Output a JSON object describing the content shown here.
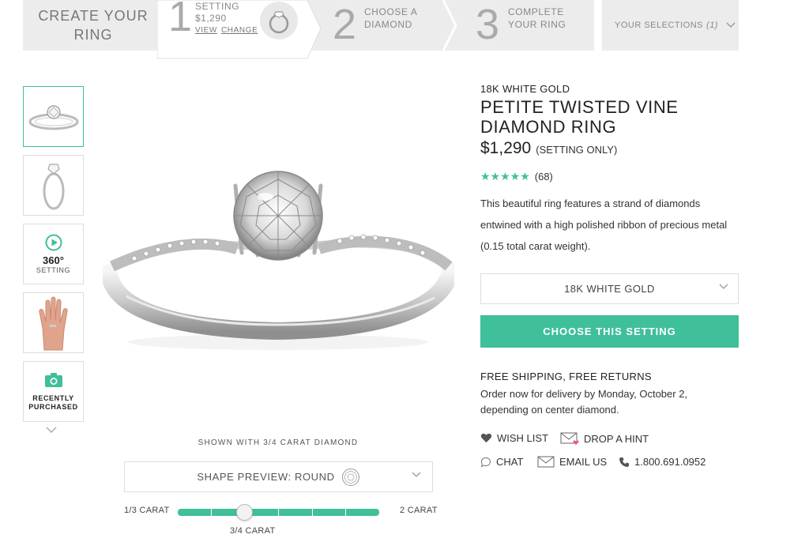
{
  "steps": {
    "create": "CREATE YOUR RING",
    "step1": {
      "number": "1",
      "label": "SETTING",
      "price": "$1,290",
      "view": "VIEW",
      "change": "CHANGE"
    },
    "step2": {
      "number": "2",
      "label_line1": "CHOOSE A",
      "label_line2": "DIAMOND"
    },
    "step3": {
      "number": "3",
      "label_line1": "COMPLETE",
      "label_line2": "YOUR RING"
    },
    "selections": {
      "label": "YOUR SELECTIONS",
      "count": "(1)"
    }
  },
  "thumbnails": [
    {
      "type": "image",
      "icon": "ring-front-icon",
      "active": true
    },
    {
      "type": "image",
      "icon": "ring-side-icon",
      "active": false
    },
    {
      "type": "video",
      "icon": "play-icon",
      "big": "360°",
      "small": "SETTING"
    },
    {
      "type": "image",
      "icon": "hand-icon",
      "active": false
    },
    {
      "type": "photo",
      "icon": "camera-icon",
      "line1": "RECENTLY",
      "line2": "PURCHASED"
    }
  ],
  "preview": {
    "shown_with": "SHOWN WITH 3/4 CARAT DIAMOND",
    "shape_label": "SHAPE PREVIEW: ROUND",
    "carat_min": "1/3 CARAT",
    "carat_max": "2 CARAT",
    "carat_current": "3/4 CARAT",
    "carat_position": 0.33
  },
  "product": {
    "metal": "18K WHITE GOLD",
    "title": "PETITE TWISTED VINE DIAMOND RING",
    "price": "$1,290",
    "price_note": "(SETTING ONLY)",
    "stars": "★★★★★",
    "review_count": "(68)",
    "description": "This beautiful ring features a strand of diamonds entwined with a high polished ribbon of precious metal (0.15 total carat weight).",
    "metal_select": "18K WHITE GOLD",
    "cta": "CHOOSE THIS SETTING",
    "shipping_title": "FREE SHIPPING, FREE RETURNS",
    "shipping_text": "Order now for delivery by Monday, October 2, depending on center diamond."
  },
  "actions": {
    "wish_list": "WISH LIST",
    "drop_hint": "DROP A HINT",
    "chat": "CHAT",
    "email": "EMAIL US",
    "phone": "1.800.691.0952"
  },
  "colors": {
    "accent": "#3fbf9a",
    "bar_bg": "#ececec",
    "text": "#222222"
  }
}
